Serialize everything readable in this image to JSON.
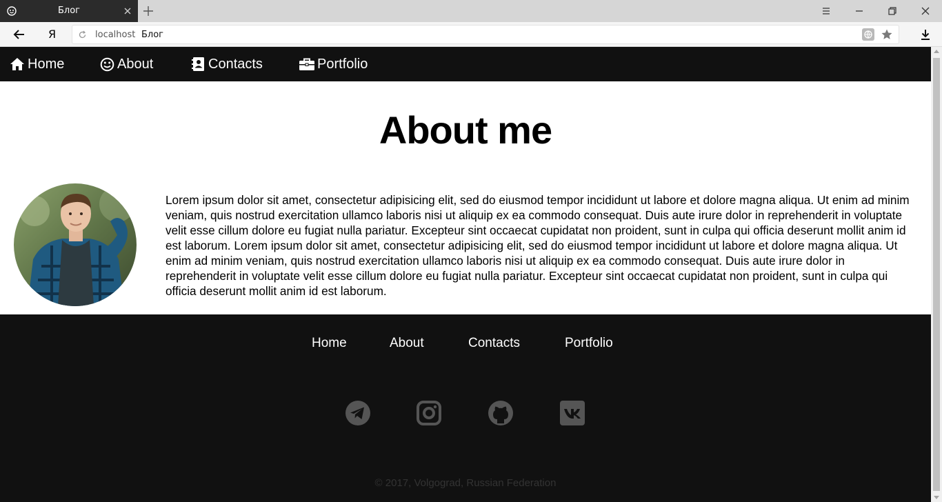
{
  "browser": {
    "tab_title": "Блог",
    "yandex_label": "Я",
    "url_host": "localhost",
    "url_title": "Блог"
  },
  "nav": {
    "items": [
      {
        "label": "Home",
        "icon": "home-icon"
      },
      {
        "label": "About",
        "icon": "smile-icon"
      },
      {
        "label": "Contacts",
        "icon": "address-book-icon"
      },
      {
        "label": "Portfolio",
        "icon": "briefcase-icon"
      }
    ]
  },
  "main": {
    "title": "About me",
    "bio": "Lorem ipsum dolor sit amet, consectetur adipisicing elit, sed do eiusmod tempor incididunt ut labore et dolore magna aliqua. Ut enim ad minim veniam, quis nostrud exercitation ullamco laboris nisi ut aliquip ex ea commodo consequat. Duis aute irure dolor in reprehenderit in voluptate velit esse cillum dolore eu fugiat nulla pariatur. Excepteur sint occaecat cupidatat non proident, sunt in culpa qui officia deserunt mollit anim id est laborum. Lorem ipsum dolor sit amet, consectetur adipisicing elit, sed do eiusmod tempor incididunt ut labore et dolore magna aliqua. Ut enim ad minim veniam, quis nostrud exercitation ullamco laboris nisi ut aliquip ex ea commodo consequat. Duis aute irure dolor in reprehenderit in voluptate velit esse cillum dolore eu fugiat nulla pariatur. Excepteur sint occaecat cupidatat non proident, sunt in culpa qui officia deserunt mollit anim id est laborum."
  },
  "footer": {
    "links": [
      {
        "label": "Home"
      },
      {
        "label": "About"
      },
      {
        "label": "Contacts"
      },
      {
        "label": "Portfolio"
      }
    ],
    "social": [
      "telegram-icon",
      "instagram-icon",
      "github-icon",
      "vk-icon"
    ],
    "copyright": "© 2017, Volgograd, Russian Federation"
  },
  "colors": {
    "nav_bg": "#111111",
    "footer_bg": "#111111",
    "social_icon": "#555555",
    "copyright_text": "#333333"
  }
}
